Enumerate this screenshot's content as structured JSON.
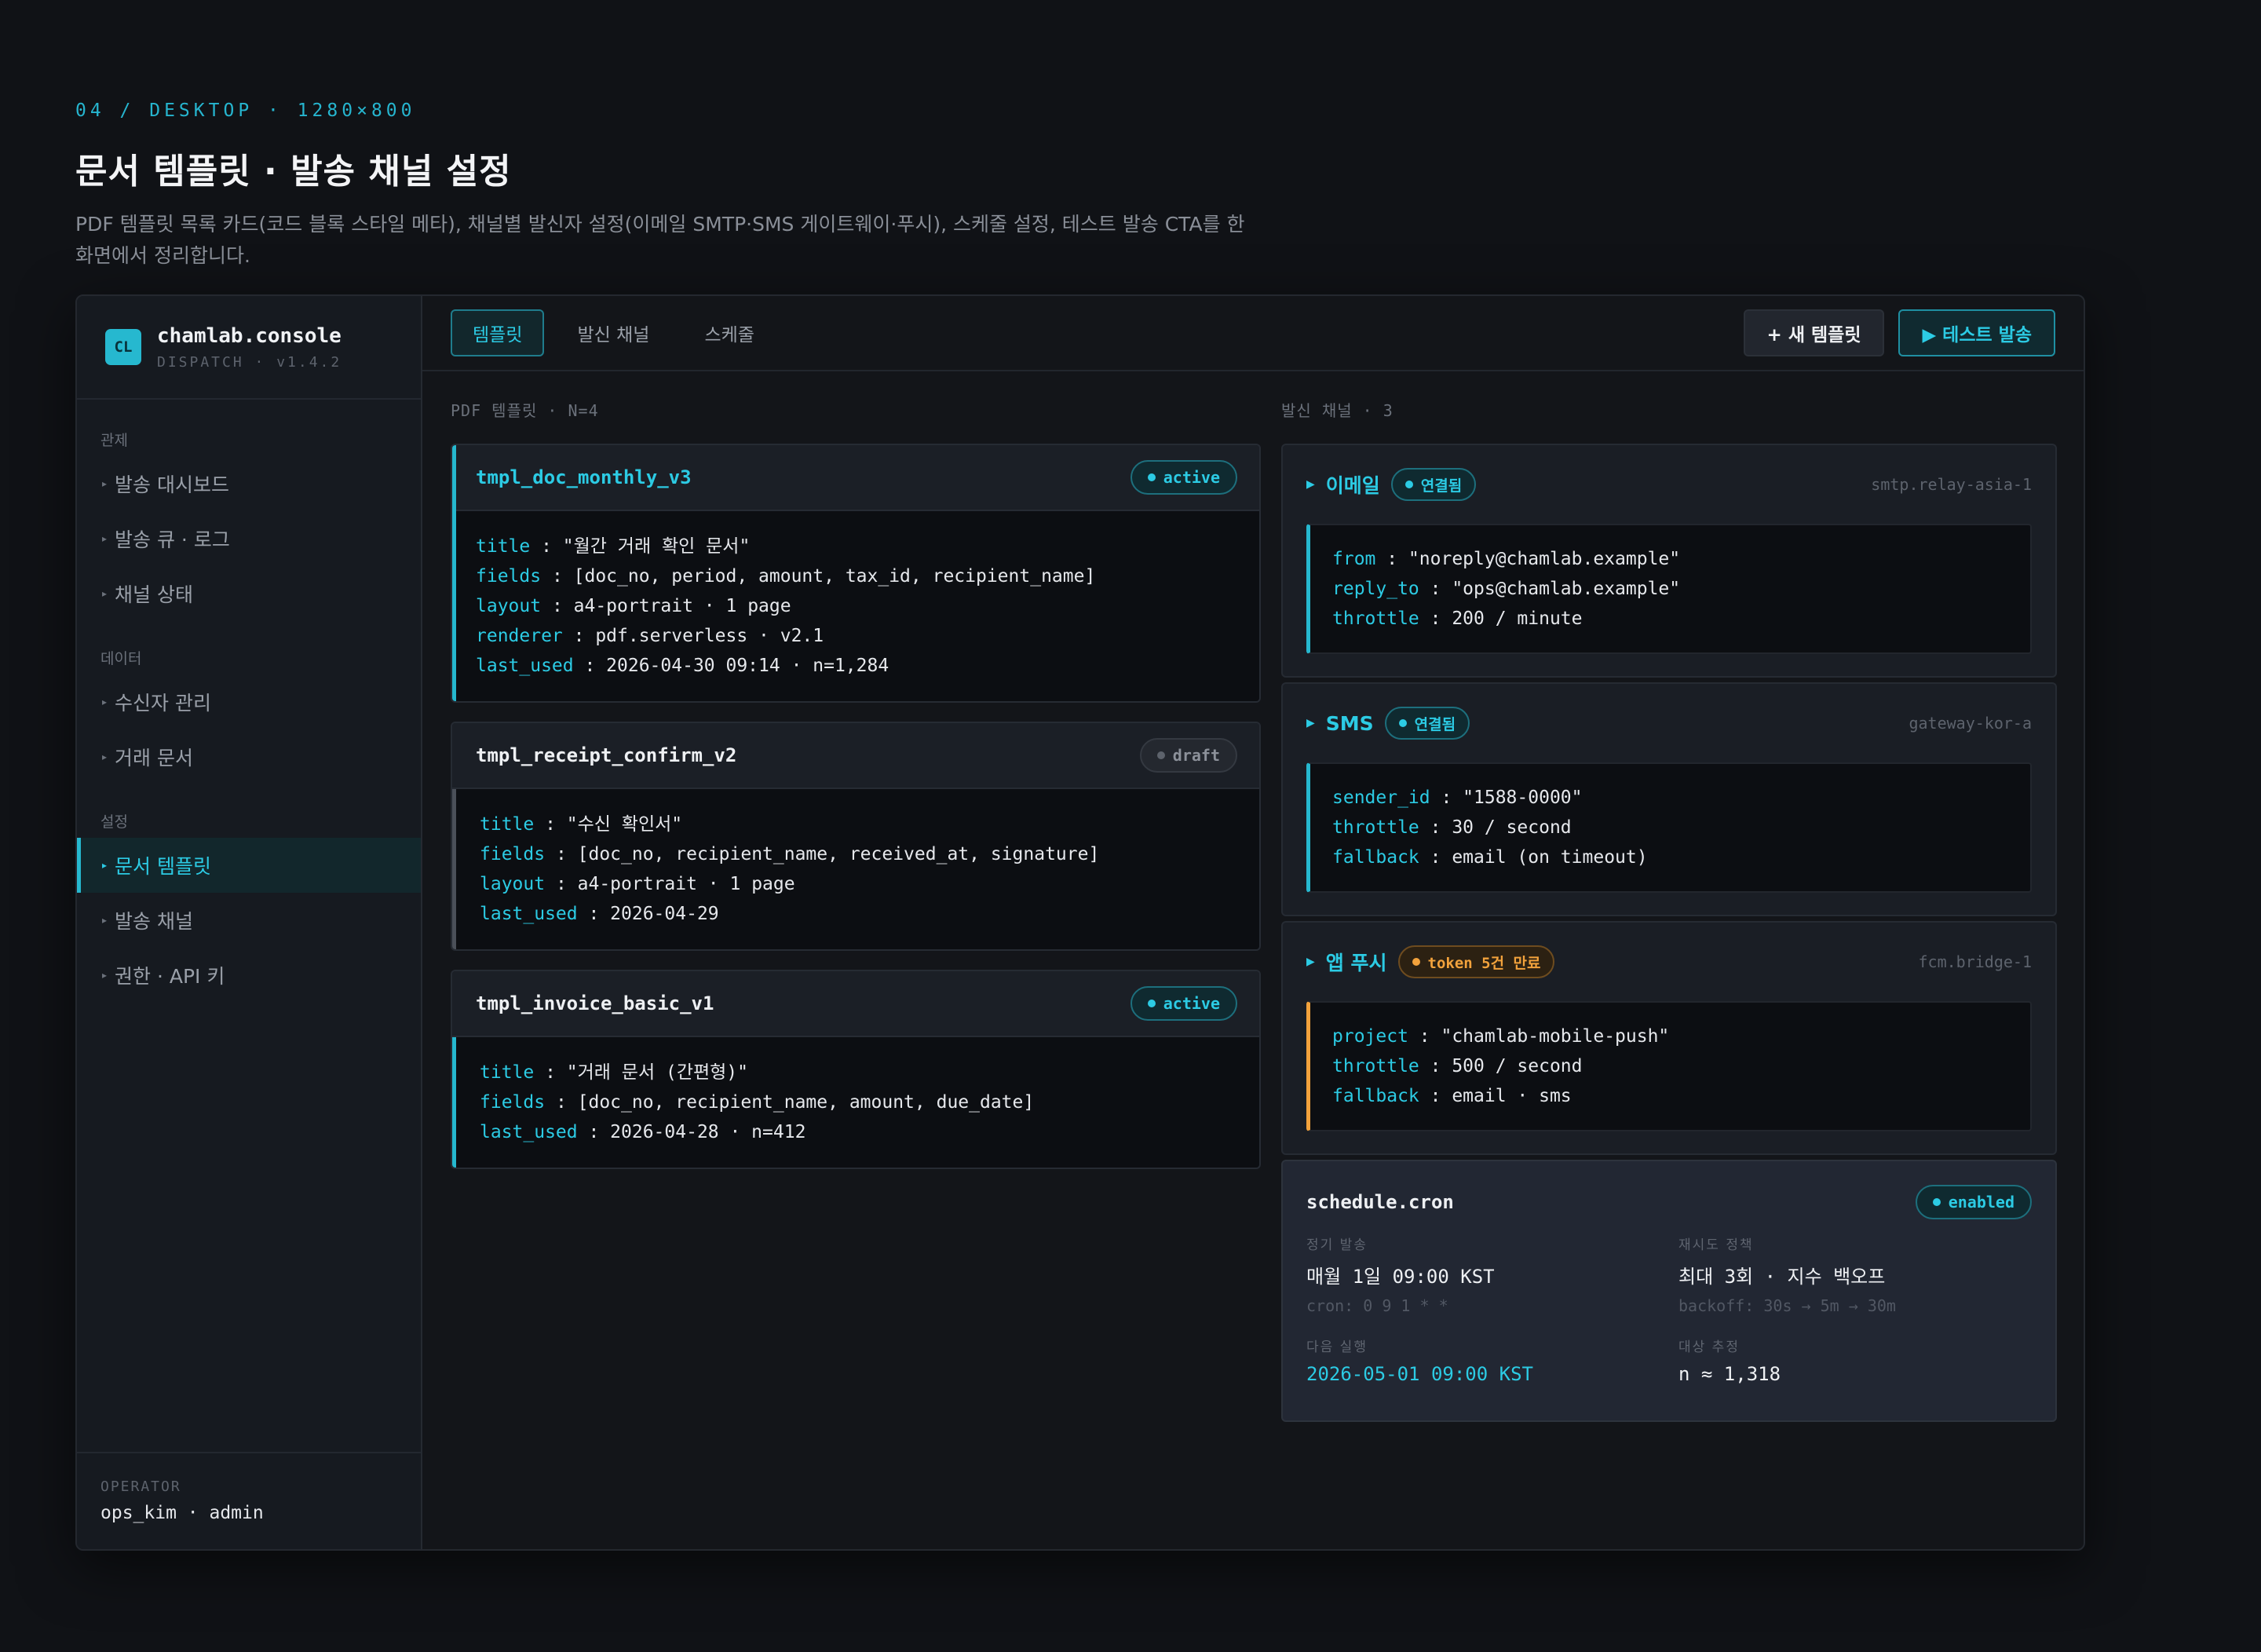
{
  "page": {
    "eyebrow": "04 / DESKTOP · 1280×800",
    "title": "문서 템플릿 · 발송 채널 설정",
    "description": "PDF 템플릿 목록 카드(코드 블록 스타일 메타), 채널별 발신자 설정(이메일 SMTP·SMS 게이트웨이·푸시), 스케줄 설정, 테스트 발송 CTA를 한 화면에서 정리합니다."
  },
  "brand": {
    "logo": "CL",
    "name": "chamlab.console",
    "sub": "DISPATCH · v1.4.2"
  },
  "sidebar": {
    "sections": [
      {
        "label": "관제",
        "items": [
          "발송 대시보드",
          "발송 큐 · 로그",
          "채널 상태"
        ]
      },
      {
        "label": "데이터",
        "items": [
          "수신자 관리",
          "거래 문서"
        ]
      },
      {
        "label": "설정",
        "items": [
          "문서 템플릿",
          "발송 채널",
          "권한 · API 키"
        ]
      }
    ],
    "active_item": "문서 템플릿"
  },
  "operator": {
    "label": "OPERATOR",
    "value": "ops_kim · admin"
  },
  "tabs": [
    "템플릿",
    "발신 채널",
    "스케줄"
  ],
  "active_tab": "템플릿",
  "actions": {
    "new_template": "+ 새 템플릿",
    "test_send": "▶ 테스트 발송"
  },
  "templates_label": "PDF 템플릿 · N=4",
  "channels_label": "발신 채널 · 3",
  "templates": [
    {
      "name": "tmpl_doc_monthly_v3",
      "status": "active",
      "rows": [
        {
          "k": "title",
          "v": "\"월간 거래 확인 문서\""
        },
        {
          "k": "fields",
          "v": "[doc_no, period, amount, tax_id, recipient_name]"
        },
        {
          "k": "layout",
          "v": "a4-portrait · 1 page"
        },
        {
          "k": "renderer",
          "v": "pdf.serverless · v2.1"
        },
        {
          "k": "last_used",
          "v": "2026-04-30 09:14 · n=1,284"
        }
      ]
    },
    {
      "name": "tmpl_receipt_confirm_v2",
      "status": "draft",
      "rows": [
        {
          "k": "title",
          "v": "\"수신 확인서\""
        },
        {
          "k": "fields",
          "v": "[doc_no, recipient_name, received_at, signature]"
        },
        {
          "k": "layout",
          "v": "a4-portrait · 1 page"
        },
        {
          "k": "last_used",
          "v": "2026-04-29"
        }
      ]
    },
    {
      "name": "tmpl_invoice_basic_v1",
      "status": "active",
      "rows": [
        {
          "k": "title",
          "v": "\"거래 문서 (간편형)\""
        },
        {
          "k": "fields",
          "v": "[doc_no, recipient_name, amount, due_date]"
        },
        {
          "k": "last_used",
          "v": "2026-04-28 · n=412"
        }
      ]
    }
  ],
  "channels": [
    {
      "name": "이메일",
      "status": "연결됨",
      "host": "smtp.relay-asia-1",
      "rows": [
        {
          "k": "from",
          "v": "\"noreply@chamlab.example\""
        },
        {
          "k": "reply_to",
          "v": "\"ops@chamlab.example\""
        },
        {
          "k": "throttle",
          "v": "200 / minute"
        }
      ]
    },
    {
      "name": "SMS",
      "status": "연결됨",
      "host": "gateway-kor-a",
      "rows": [
        {
          "k": "sender_id",
          "v": "\"1588-0000\""
        },
        {
          "k": "throttle",
          "v": "30 / second"
        },
        {
          "k": "fallback",
          "v": "email (on timeout)"
        }
      ]
    },
    {
      "name": "앱 푸시",
      "status": "token 5건 만료",
      "host": "fcm.bridge-1",
      "rows": [
        {
          "k": "project",
          "v": "\"chamlab-mobile-push\""
        },
        {
          "k": "throttle",
          "v": "500 / second"
        },
        {
          "k": "fallback",
          "v": "email · sms"
        }
      ]
    }
  ],
  "schedule": {
    "title": "schedule.cron",
    "status": "enabled",
    "regular": {
      "label": "정기 발송",
      "value": "매월 1일 09:00 KST",
      "sub": "cron: 0 9 1 * *"
    },
    "retry": {
      "label": "재시도 정책",
      "value": "최대 3회 · 지수 백오프",
      "sub": "backoff: 30s → 5m → 30m"
    },
    "next_run": {
      "label": "다음 실행",
      "value": "2026-05-01 09:00 KST"
    },
    "target": {
      "label": "대상 추정",
      "value": "n ≈ 1,318"
    }
  },
  "colors": {
    "accent": "#2ccbe4",
    "warning": "#f2a23c",
    "muted": "#5d636d"
  }
}
